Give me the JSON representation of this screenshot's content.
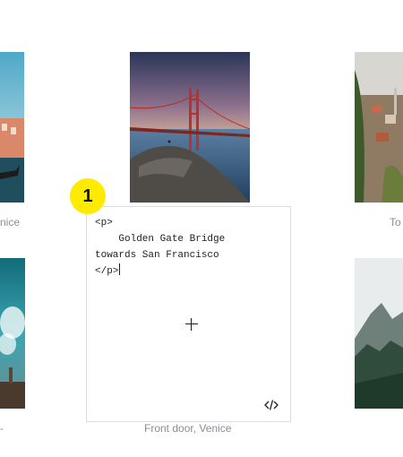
{
  "gallery": {
    "captions": {
      "left_top": "nice",
      "right_top": "To",
      "center": "Front door, Venice",
      "left_bottom": "-"
    }
  },
  "code_block": {
    "lines": [
      "<p>",
      "    Golden Gate Bridge",
      "towards San Francisco",
      "</p>"
    ]
  },
  "badge": {
    "label": "1"
  },
  "colors": {
    "badge": "#ffeb00",
    "caption": "#8a8d94",
    "border": "#dcdcdc"
  },
  "icons": {
    "add": "plus-icon",
    "html": "code-icon"
  }
}
